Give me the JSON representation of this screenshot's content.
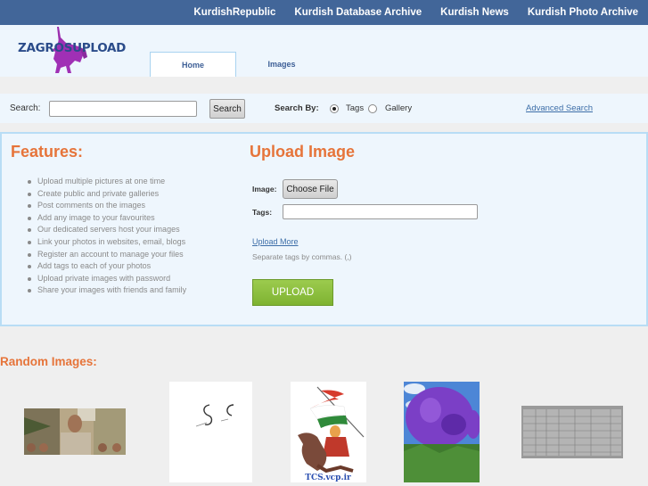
{
  "top_nav": {
    "links": [
      {
        "label": "KurdishRepublic"
      },
      {
        "label": "Kurdish Database Archive"
      },
      {
        "label": "Kurdish News"
      },
      {
        "label": "Kurdish Photo Archive"
      }
    ]
  },
  "header": {
    "logo_text": "ZAGROSUPLOAD",
    "tabs": [
      {
        "label": "Home",
        "active": true
      },
      {
        "label": "Images",
        "active": false
      }
    ]
  },
  "search": {
    "label": "Search:",
    "value": "",
    "button_label": "Search",
    "search_by_label": "Search By:",
    "options": [
      {
        "label": "Tags",
        "checked": true
      },
      {
        "label": "Gallery",
        "checked": false
      }
    ],
    "advanced_link": "Advanced Search"
  },
  "features": {
    "title": "Features:",
    "items": [
      "Upload multiple pictures at one time",
      "Create public and private galleries",
      "Post comments on the images",
      "Add any image to your favourites",
      "Our dedicated servers host your images",
      "Link your photos in websites, email, blogs",
      "Register an account to manage your files",
      "Add tags to each of your photos",
      "Upload private images with password",
      "Share your images with friends and family"
    ]
  },
  "upload": {
    "title": "Upload Image",
    "image_label": "Image:",
    "choose_file_label": "Choose File",
    "tags_label": "Tags:",
    "tags_value": "",
    "upload_more_link": "Upload More",
    "hint": "Separate tags by commas. (,)",
    "upload_button": "UPLOAD"
  },
  "random_images": {
    "title": "Random Images:",
    "images": [
      {
        "description": "man-with-crowd-photo"
      },
      {
        "description": "calligraphy-sketch"
      },
      {
        "description": "rider-with-flag-illustration",
        "caption": "TCS.vcp.ir"
      },
      {
        "description": "purple-flowers-photo"
      },
      {
        "description": "document-table-scan"
      }
    ]
  },
  "colors": {
    "top_bar": "#426699",
    "accent_orange": "#e6743a",
    "panel_bg": "#eef6fd",
    "panel_border": "#b8ddf5",
    "upload_green": "#8ac03e",
    "link_blue": "#3d6ea8"
  }
}
